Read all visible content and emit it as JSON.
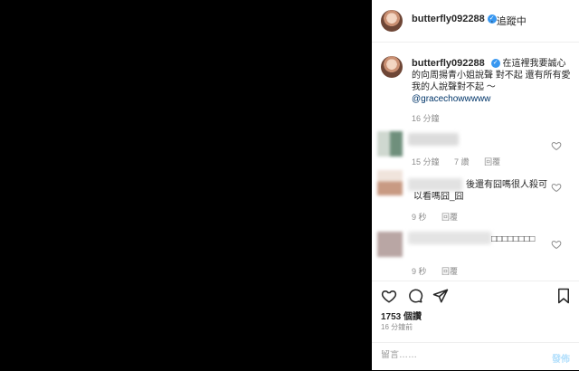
{
  "header": {
    "username": "butterfly092288",
    "follow_status": "· 追蹤中"
  },
  "caption": {
    "username": "butterfly092288",
    "text": "在這裡我要誠心的向周揚青小姐說聲 對不起 還有所有愛我的人說聲對不起 ～",
    "mention": "@gracechowwwww",
    "time": "16 分鐘"
  },
  "comments": [
    {
      "text": "",
      "time": "15 分鐘",
      "likes": "7 讚",
      "reply": "回覆"
    },
    {
      "text": "後還有囧嗎很人殺可以看嗎囧_囧",
      "time": "9 秒",
      "reply": "回覆"
    },
    {
      "text": "□□□□□□□□",
      "time": "9 秒",
      "reply": "回覆"
    }
  ],
  "actions": {
    "like_icon": "heart-icon",
    "comment_icon": "comment-icon",
    "share_icon": "share-icon",
    "save_icon": "bookmark-icon"
  },
  "likes": "1753 個讚",
  "posted": "16 分鐘前",
  "comment_box": {
    "placeholder": "留言……",
    "post_label": "發佈"
  },
  "colors": {
    "verified": "#3897f0",
    "post_disabled": "#b2dffc",
    "meta": "#8e8e8e"
  }
}
